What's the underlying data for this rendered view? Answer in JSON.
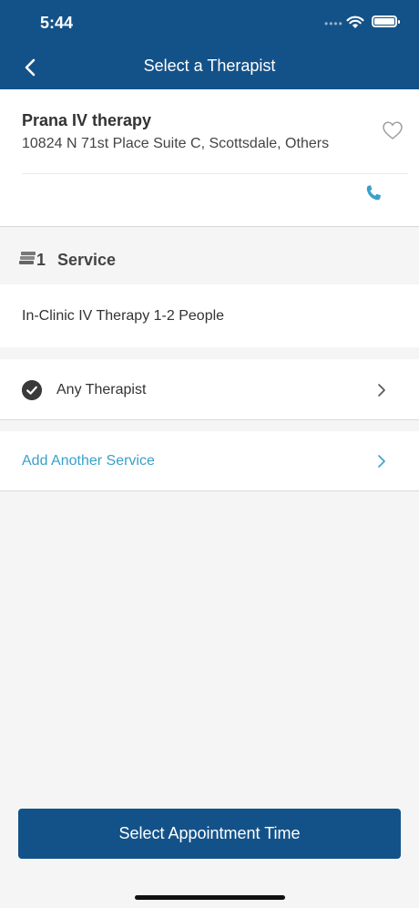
{
  "status_bar": {
    "time": "5:44",
    "dots": "••••"
  },
  "nav": {
    "title": "Select a Therapist"
  },
  "clinic": {
    "name": "Prana IV therapy",
    "address": "10824 N 71st Place Suite C, Scottsdale, Others"
  },
  "services": {
    "count": "1",
    "title": "Service",
    "items": [
      {
        "name": "In-Clinic IV Therapy 1-2 People"
      }
    ]
  },
  "therapist": {
    "label": "Any Therapist"
  },
  "add_service": {
    "label": "Add Another Service"
  },
  "cta": {
    "label": "Select Appointment Time"
  },
  "colors": {
    "brand_blue": "#135289",
    "link_blue": "#3aa0c9",
    "background": "#f5f5f5"
  },
  "icons": [
    "back-chevron-icon",
    "heart-icon",
    "phone-icon",
    "services-stack-icon",
    "checkmark-icon",
    "chevron-right-icon"
  ]
}
